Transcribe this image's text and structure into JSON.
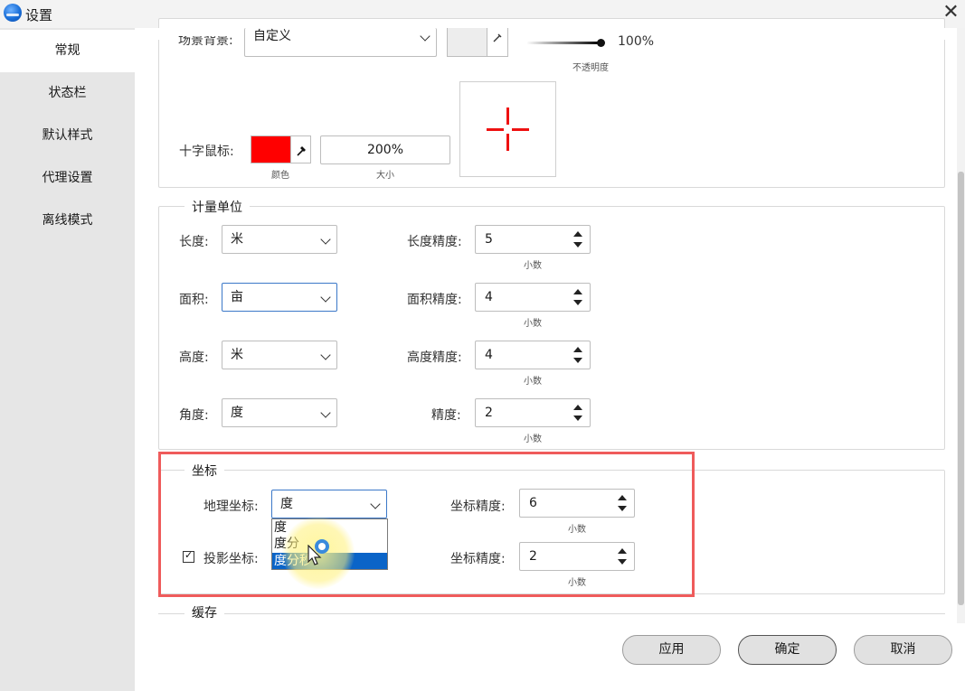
{
  "window": {
    "title": "设置",
    "close_glyph": "✕"
  },
  "sidebar": {
    "items": [
      {
        "label": "常规",
        "active": true
      },
      {
        "label": "状态栏",
        "active": false
      },
      {
        "label": "默认样式",
        "active": false
      },
      {
        "label": "代理设置",
        "active": false
      },
      {
        "label": "离线模式",
        "active": false
      }
    ]
  },
  "scene": {
    "background_label": "场景背景:",
    "background_value": "自定义",
    "opacity_value": "100%",
    "opacity_caption": "不透明度",
    "opacity_level": 1.0,
    "bg_color": "#ededed"
  },
  "crosshair": {
    "label": "十字鼠标:",
    "color": "#ff0000",
    "color_caption": "颜色",
    "size_value": "200%",
    "size_caption": "大小"
  },
  "units": {
    "legend": "计量单位",
    "rows": [
      {
        "label": "长度:",
        "value": "米",
        "precision_label": "长度精度:",
        "precision": "5",
        "caption": "小数"
      },
      {
        "label": "面积:",
        "value": "亩",
        "precision_label": "面积精度:",
        "precision": "4",
        "caption": "小数"
      },
      {
        "label": "高度:",
        "value": "米",
        "precision_label": "高度精度:",
        "precision": "4",
        "caption": "小数"
      },
      {
        "label": "角度:",
        "value": "度",
        "precision_label": "精度:",
        "precision": "2",
        "caption": "小数"
      }
    ]
  },
  "coords": {
    "legend": "坐标",
    "geo_label": "地理坐标:",
    "geo_value": "度",
    "geo_precision_label": "坐标精度:",
    "geo_precision": "6",
    "geo_caption": "小数",
    "proj_label": "投影坐标:",
    "proj_checked": true,
    "check_glyph": "✓",
    "proj_precision_label": "坐标精度:",
    "proj_precision": "2",
    "proj_caption": "小数",
    "dropdown_options": [
      "度",
      "度分",
      "度分秒"
    ],
    "dropdown_selected": "度分秒"
  },
  "cache": {
    "legend": "缓存"
  },
  "footer": {
    "apply": "应用",
    "ok": "确定",
    "cancel": "取消"
  },
  "colors": {
    "highlight": "#ef5b5b",
    "selection": "#0a64c8"
  }
}
